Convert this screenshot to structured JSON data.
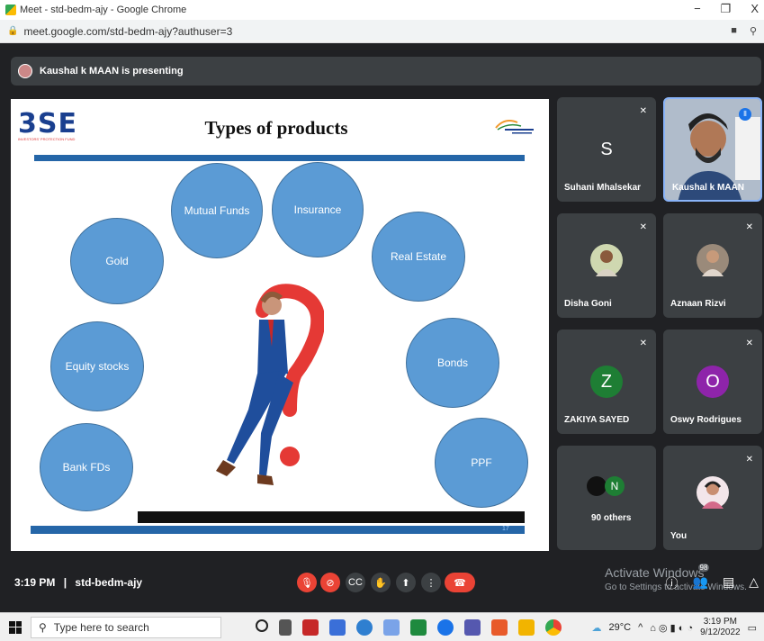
{
  "browser": {
    "tab_title": "Meet - std-bedm-ajy - Google Chrome",
    "url": "meet.google.com/std-bedm-ajy?authuser=3",
    "minimize": "−",
    "restore": "❐",
    "close": "X"
  },
  "presenter_banner": "Kaushal k MAAN is presenting",
  "slide": {
    "logo": "3SE",
    "logo_sub": "INVESTORS' PROTECTION FUND",
    "title": "Types of products",
    "page_number": "17",
    "products": [
      "Mutual Funds",
      "Insurance",
      "Gold",
      "Real Estate",
      "Equity stocks",
      "Bonds",
      "Bank FDs",
      "PPF"
    ]
  },
  "participants": [
    {
      "name": "Suhani Mhalsekar",
      "initial": "S",
      "color": "#e8542f"
    },
    {
      "name": "Kaushal k MAAN"
    },
    {
      "name": "Disha Goni"
    },
    {
      "name": "Aznaan Rizvi"
    },
    {
      "name": "ZAKIYA SAYED",
      "initial": "Z",
      "color": "#1e7e34"
    },
    {
      "name": "Oswy Rodrigues",
      "initial": "O",
      "color": "#8e24aa"
    },
    {
      "name": "90 others",
      "initial": "N"
    },
    {
      "name": "You"
    }
  ],
  "controls": {
    "time": "3:19 PM",
    "separator": "|",
    "meeting_code": "std-bedm-ajy",
    "people_count": "98"
  },
  "watermark": {
    "line1": "Activate Windows",
    "line2": "Go to Settings to activate Windows."
  },
  "taskbar": {
    "search_placeholder": "Type here to search",
    "weather": "29°C",
    "time": "3:19 PM",
    "date": "9/12/2022"
  }
}
